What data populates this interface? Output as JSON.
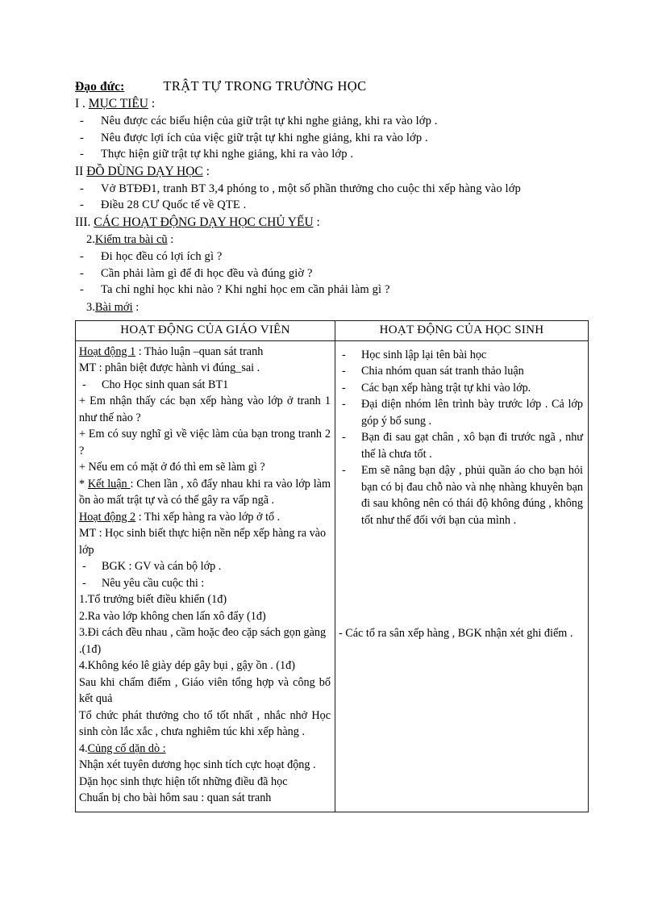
{
  "document": {
    "subject_label": "Đạo đức:",
    "lesson_title": "TRẬT TỰ TRONG TRƯỜNG HỌC",
    "section_1": {
      "number": "I . ",
      "heading": "MỤC TIÊU",
      "colon": " :",
      "items": [
        "Nêu được các biểu hiện của giữ trật tự  khi nghe  giảng,  khi ra vào lớp  .",
        "Nêu được lợi ích của việc  giữ trật tự  khi nghe  giảng,  khi ra vào lớp  .",
        "Thực hiện  giữ trật tự  khi nghe  giảng,  khi ra vào lớp  ."
      ]
    },
    "section_2": {
      "number": "II ",
      "heading": "ĐỒ DÙNG DẠY HỌC",
      "colon": " :",
      "items": [
        "Vở BTĐĐ1,  tranh BT 3,4 phóng to , một số phần  thưởng  cho cuộc thi  xếp hàng  vào lớp",
        "Điều 28 CƯ Quốc tế về QTE ."
      ]
    },
    "section_3": {
      "number": "III. ",
      "heading": "CÁC HOẠT ĐỘNG DẠY HỌC CHỦ YẾU",
      "colon": " :",
      "sub_a": {
        "number": "2.",
        "heading": "Kiểm  tra bài cũ",
        "colon": " :",
        "items": [
          "Đi học đều có lợi ích gì ?",
          "Cần phải làm gì để đi học đều và đúng giờ ?",
          "Ta chỉ nghỉ  học khi nào ? Khi nghỉ  học em cần phải làm gì ?"
        ]
      },
      "sub_b": {
        "number": "3.",
        "heading": "Bài mới",
        "colon": " :"
      }
    },
    "table": {
      "header_left": "HOẠT ĐỘNG CỦA GIÁO VIÊN",
      "header_right": "HOẠT ĐỘNG CỦA HỌC SINH",
      "left_blocks": [
        {
          "type": "underlined_lead",
          "lead": "Hoạt động 1",
          "rest": " : Thảo luận  –quan sát tranh"
        },
        {
          "type": "plain",
          "text": "MT : phân  biệt  được hành  vi đúng_sai ."
        },
        {
          "type": "dash",
          "text": "Cho Học sinh   quan sát BT1"
        },
        {
          "type": "plain",
          "text": "+ Em nhận  thấy  các  bạn  xếp  hàng  vào  lớp  ở tranh  1 như thế nào ?"
        },
        {
          "type": "plain",
          "text": "+ Em có suy nghĩ  gì về việc  làm  của bạn trong tranh  2 ?"
        },
        {
          "type": "plain",
          "text": "+ Nếu em có mặt ở đó thì  em sẽ làm gì ?"
        },
        {
          "type": "underlined_mid",
          "prefix": "* ",
          "lead": "Kết luận ",
          "rest": " : Chen  lần , xô  đẩy nhau  khi  ra vào lớp  làm  ồn  ào mất trật tự và có thể  gây ra vấp ngã ."
        },
        {
          "type": "underlined_lead",
          "lead": "Hoạt động 2",
          "rest": " : Thi  xếp  hàng  ra vào  lớp  ở tổ ."
        },
        {
          "type": "plain",
          "text": "MT : Học sinh  biết thực hiện  nền nếp xếp hàng ra vào lớp"
        },
        {
          "type": "dash",
          "text": "BGK : GV và cán bộ lớp ."
        },
        {
          "type": "dash",
          "text": "Nêu yêu cầu cuộc thi :"
        },
        {
          "type": "plain",
          "text": "1.Tổ trưởng biết điều khiển   (1đ)"
        },
        {
          "type": "plain",
          "text": "2.Ra vào lớp không  chen lấn xô đẩy (1đ)"
        },
        {
          "type": "plain",
          "text": "3.Đi  cách  đều nhau  ,  cầm  hoặc  đeo cặp sách gọn gàng .(1đ)"
        },
        {
          "type": "plain",
          "text": "4.Không kéo lê giày  dép gây bụi , gậy ồn . (1đ)"
        },
        {
          "type": "plain",
          "text": "Sau  khi  chấm  điểm  ,  Giáo  viên  tổng  hợp  và công bố kết quả"
        },
        {
          "type": "plain",
          "text": "Tổ chức phát  thưởng  cho tổ tốt nhất , nhắc nhở Học sinh  còn lắc xắc , chưa nghiêm  túc khi xếp hàng ."
        },
        {
          "type": "underlined_mid",
          "prefix": "4.",
          "lead": "Củng  cố dặn dò : ",
          "rest": ""
        },
        {
          "type": "plain",
          "text": "Nhận xét   tuyên  dương học  sinh  tích  cực hoạt động ."
        },
        {
          "type": "plain",
          "text": "Dặn học sinh thực hiện tốt những  điều đã học"
        },
        {
          "type": "plain",
          "text": "Chuẩn  bị  cho  bài  hôm  sau  :  quan  sát  tranh"
        }
      ],
      "right_bullets": [
        "Học sinh  lập lại tên bài học",
        "Chia nhóm  quan sát  tranh  thảo luận",
        "Các bạn xếp hàng trật tự khi vào lớp.",
        "Đại  diện  nhóm  lên  trình  bày trước lớp . Cả lớp góp ý bổ sung .",
        "Bạn đi sau gạt chân , xô bạn đi trước ngã , như thế là chưa tốt .",
        "Em sẽ nâng bạn dậy , phủi quần   áo cho bạn hỏi  bạn có bị  đau  chỗ nào và nhẹ nhàng  khuyên  bạn đi sau không  nên có thái  độ không  đúng  , không  tốt như thế đối với bạn của mình ."
      ],
      "right_tail": "- Các tổ ra sân xếp hàng , BGK nhận  xét ghi điểm ."
    }
  }
}
